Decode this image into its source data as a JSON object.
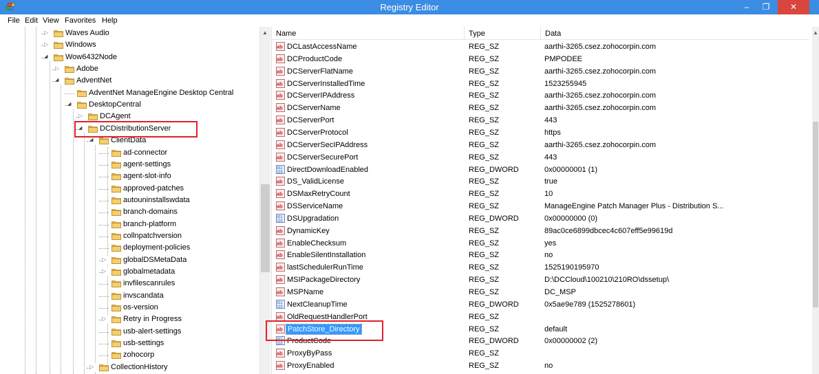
{
  "window": {
    "title": "Registry Editor",
    "minimize_glyph": "–",
    "maximize_glyph": "❐",
    "close_glyph": "✕"
  },
  "menu": [
    "File",
    "Edit",
    "View",
    "Favorites",
    "Help"
  ],
  "tree": {
    "items": [
      {
        "label": "Waves Audio",
        "expander": "collapsed"
      },
      {
        "label": "Windows",
        "expander": "collapsed"
      },
      {
        "label": "Wow6432Node",
        "expander": "expanded"
      },
      {
        "label": "Adobe",
        "expander": "collapsed"
      },
      {
        "label": "AdventNet",
        "expander": "expanded"
      },
      {
        "label": "AdventNet ManageEngine Desktop Central",
        "expander": "none"
      },
      {
        "label": "DesktopCentral",
        "expander": "expanded"
      },
      {
        "label": "DCAgent",
        "expander": "collapsed"
      },
      {
        "label": "DCDistributionServer",
        "expander": "expanded",
        "highlighted": true
      },
      {
        "label": "ClientData",
        "expander": "expanded"
      },
      {
        "label": "ad-connector",
        "expander": "none"
      },
      {
        "label": "agent-settings",
        "expander": "none"
      },
      {
        "label": "agent-slot-info",
        "expander": "none"
      },
      {
        "label": "approved-patches",
        "expander": "none"
      },
      {
        "label": "autouninstallswdata",
        "expander": "none"
      },
      {
        "label": "branch-domains",
        "expander": "none"
      },
      {
        "label": "branch-platform",
        "expander": "none"
      },
      {
        "label": "collnpatchversion",
        "expander": "none"
      },
      {
        "label": "deployment-policies",
        "expander": "none"
      },
      {
        "label": "globalDSMetaData",
        "expander": "collapsed"
      },
      {
        "label": "globalmetadata",
        "expander": "collapsed"
      },
      {
        "label": "invfilescanrules",
        "expander": "none"
      },
      {
        "label": "invscandata",
        "expander": "none"
      },
      {
        "label": "os-version",
        "expander": "none"
      },
      {
        "label": "Retry in Progress",
        "expander": "collapsed"
      },
      {
        "label": "usb-alert-settings",
        "expander": "none"
      },
      {
        "label": "usb-settings",
        "expander": "none"
      },
      {
        "label": "zohocorp",
        "expander": "none"
      },
      {
        "label": "CollectionHistory",
        "expander": "collapsed"
      }
    ]
  },
  "list": {
    "columns": [
      "Name",
      "Type",
      "Data"
    ],
    "rows": [
      {
        "icon": "string-value-icon",
        "name": "DCLastAccessName",
        "type": "REG_SZ",
        "data": "aarthi-3265.csez.zohocorpin.com"
      },
      {
        "icon": "string-value-icon",
        "name": "DCProductCode",
        "type": "REG_SZ",
        "data": "PMPODEE"
      },
      {
        "icon": "string-value-icon",
        "name": "DCServerFlatName",
        "type": "REG_SZ",
        "data": "aarthi-3265.csez.zohocorpin.com"
      },
      {
        "icon": "string-value-icon",
        "name": "DCServerInstalledTime",
        "type": "REG_SZ",
        "data": "1523255945"
      },
      {
        "icon": "string-value-icon",
        "name": "DCServerIPAddress",
        "type": "REG_SZ",
        "data": "aarthi-3265.csez.zohocorpin.com"
      },
      {
        "icon": "string-value-icon",
        "name": "DCServerName",
        "type": "REG_SZ",
        "data": "aarthi-3265.csez.zohocorpin.com"
      },
      {
        "icon": "string-value-icon",
        "name": "DCServerPort",
        "type": "REG_SZ",
        "data": "443"
      },
      {
        "icon": "string-value-icon",
        "name": "DCServerProtocol",
        "type": "REG_SZ",
        "data": "https"
      },
      {
        "icon": "string-value-icon",
        "name": "DCServerSecIPAddress",
        "type": "REG_SZ",
        "data": "aarthi-3265.csez.zohocorpin.com"
      },
      {
        "icon": "string-value-icon",
        "name": "DCServerSecurePort",
        "type": "REG_SZ",
        "data": "443"
      },
      {
        "icon": "dword-value-icon",
        "name": "DirectDownloadEnabled",
        "type": "REG_DWORD",
        "data": "0x00000001 (1)"
      },
      {
        "icon": "string-value-icon",
        "name": "DS_ValidLicense",
        "type": "REG_SZ",
        "data": "true"
      },
      {
        "icon": "string-value-icon",
        "name": "DSMaxRetryCount",
        "type": "REG_SZ",
        "data": "10"
      },
      {
        "icon": "string-value-icon",
        "name": "DSServiceName",
        "type": "REG_SZ",
        "data": "ManageEngine Patch Manager Plus - Distribution S..."
      },
      {
        "icon": "dword-value-icon",
        "name": "DSUpgradation",
        "type": "REG_DWORD",
        "data": "0x00000000 (0)"
      },
      {
        "icon": "string-value-icon",
        "name": "DynamicKey",
        "type": "REG_SZ",
        "data": "89ac0ce6899dbcec4c607eff5e99619d"
      },
      {
        "icon": "string-value-icon",
        "name": "EnableChecksum",
        "type": "REG_SZ",
        "data": "yes"
      },
      {
        "icon": "string-value-icon",
        "name": "EnableSilentInstallation",
        "type": "REG_SZ",
        "data": "no"
      },
      {
        "icon": "string-value-icon",
        "name": "lastSchedulerRunTime",
        "type": "REG_SZ",
        "data": "1525190195970"
      },
      {
        "icon": "string-value-icon",
        "name": "MSIPackageDirectory",
        "type": "REG_SZ",
        "data": "D:\\DCCloud\\100210\\210RO\\dssetup\\"
      },
      {
        "icon": "string-value-icon",
        "name": "MSPName",
        "type": "REG_SZ",
        "data": "DC_MSP"
      },
      {
        "icon": "dword-value-icon",
        "name": "NextCleanupTime",
        "type": "REG_DWORD",
        "data": "0x5ae9e789 (1525278601)"
      },
      {
        "icon": "string-value-icon",
        "name": "OldRequestHandlerPort",
        "type": "REG_SZ",
        "data": ""
      },
      {
        "icon": "string-value-icon",
        "name": "PatchStore_Directory",
        "type": "REG_SZ",
        "data": "default",
        "selected": true
      },
      {
        "icon": "dword-value-icon",
        "name": "ProductCode",
        "type": "REG_DWORD",
        "data": "0x00000002 (2)"
      },
      {
        "icon": "string-value-icon",
        "name": "ProxyByPass",
        "type": "REG_SZ",
        "data": ""
      },
      {
        "icon": "string-value-icon",
        "name": "ProxyEnabled",
        "type": "REG_SZ",
        "data": "no"
      }
    ]
  },
  "colors": {
    "titlebar": "#3b8ce3",
    "close_button": "#d9463d",
    "selection": "#3399ff",
    "highlight_box": "#e0202a",
    "folder": "#e8b84a"
  }
}
